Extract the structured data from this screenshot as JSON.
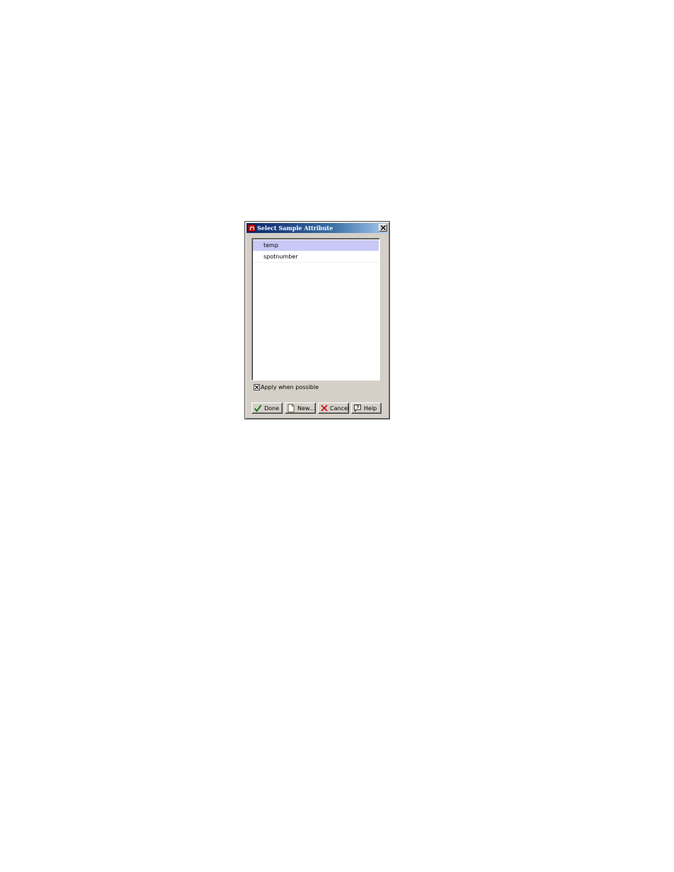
{
  "window": {
    "title": "Select Sample Attribute",
    "app_icon": "matlab-icon",
    "close_icon": "close-icon"
  },
  "list": {
    "items": [
      {
        "label": "temp",
        "selected": true
      },
      {
        "label": "spotnumber",
        "selected": false
      }
    ]
  },
  "options": {
    "apply_label": "Apply when possible",
    "apply_checked": true
  },
  "buttons": {
    "done_label": "Done",
    "new_label": "New...",
    "cancel_label": "Cancel",
    "help_label": "Help"
  },
  "colors": {
    "selection": "#c9c9f7",
    "title_start": "#0a246a",
    "title_end": "#a6caf0",
    "dialog_face": "#d4d0c8"
  }
}
